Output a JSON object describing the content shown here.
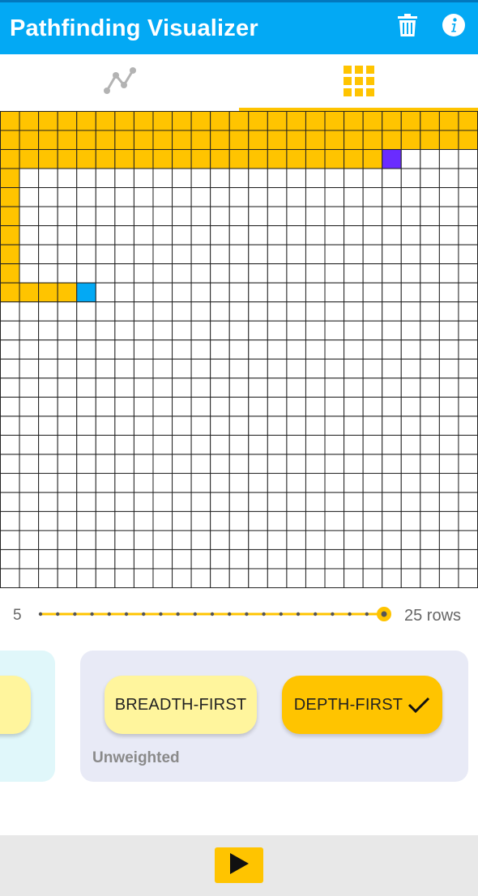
{
  "app": {
    "title": "Pathfinding Visualizer"
  },
  "appbar": {
    "actions": [
      {
        "icon": "trash-icon"
      },
      {
        "icon": "info-icon"
      }
    ]
  },
  "tabs": [
    {
      "icon": "graph-icon",
      "selected": false
    },
    {
      "icon": "grid-icon",
      "selected": true
    }
  ],
  "grid": {
    "rows": 25,
    "cols": 25,
    "visited_color": "#ffc400",
    "empty_color": "#ffffff",
    "start_color": "#03a9f4",
    "end_color": "#6a2cff",
    "visited": [
      [
        0,
        0
      ],
      [
        0,
        1
      ],
      [
        0,
        2
      ],
      [
        0,
        3
      ],
      [
        0,
        4
      ],
      [
        0,
        5
      ],
      [
        0,
        6
      ],
      [
        0,
        7
      ],
      [
        0,
        8
      ],
      [
        0,
        9
      ],
      [
        0,
        10
      ],
      [
        0,
        11
      ],
      [
        0,
        12
      ],
      [
        0,
        13
      ],
      [
        0,
        14
      ],
      [
        0,
        15
      ],
      [
        0,
        16
      ],
      [
        0,
        17
      ],
      [
        0,
        18
      ],
      [
        0,
        19
      ],
      [
        0,
        20
      ],
      [
        0,
        21
      ],
      [
        0,
        22
      ],
      [
        0,
        23
      ],
      [
        0,
        24
      ],
      [
        1,
        0
      ],
      [
        1,
        1
      ],
      [
        1,
        2
      ],
      [
        1,
        3
      ],
      [
        1,
        4
      ],
      [
        1,
        5
      ],
      [
        1,
        6
      ],
      [
        1,
        7
      ],
      [
        1,
        8
      ],
      [
        1,
        9
      ],
      [
        1,
        10
      ],
      [
        1,
        11
      ],
      [
        1,
        12
      ],
      [
        1,
        13
      ],
      [
        1,
        14
      ],
      [
        1,
        15
      ],
      [
        1,
        16
      ],
      [
        1,
        17
      ],
      [
        1,
        18
      ],
      [
        1,
        19
      ],
      [
        1,
        20
      ],
      [
        1,
        21
      ],
      [
        1,
        22
      ],
      [
        1,
        23
      ],
      [
        1,
        24
      ],
      [
        2,
        0
      ],
      [
        2,
        1
      ],
      [
        2,
        2
      ],
      [
        2,
        3
      ],
      [
        2,
        4
      ],
      [
        2,
        5
      ],
      [
        2,
        6
      ],
      [
        2,
        7
      ],
      [
        2,
        8
      ],
      [
        2,
        9
      ],
      [
        2,
        10
      ],
      [
        2,
        11
      ],
      [
        2,
        12
      ],
      [
        2,
        13
      ],
      [
        2,
        14
      ],
      [
        2,
        15
      ],
      [
        2,
        16
      ],
      [
        2,
        17
      ],
      [
        2,
        18
      ],
      [
        2,
        19
      ],
      [
        3,
        0
      ],
      [
        4,
        0
      ],
      [
        5,
        0
      ],
      [
        6,
        0
      ],
      [
        7,
        0
      ],
      [
        8,
        0
      ],
      [
        9,
        0
      ],
      [
        9,
        1
      ],
      [
        9,
        2
      ],
      [
        9,
        3
      ]
    ],
    "start": [
      9,
      4
    ],
    "end": [
      2,
      20
    ]
  },
  "slider": {
    "min_label": "5",
    "max_label": "25 rows",
    "min": 5,
    "max": 25,
    "value": 25
  },
  "algorithms": {
    "bfs_label": "BREADTH-FIRST",
    "dfs_label": "DEPTH-FIRST",
    "selected": "DEPTH-FIRST",
    "group_label": "Unweighted"
  },
  "controls": {
    "play_icon": "play-icon"
  }
}
